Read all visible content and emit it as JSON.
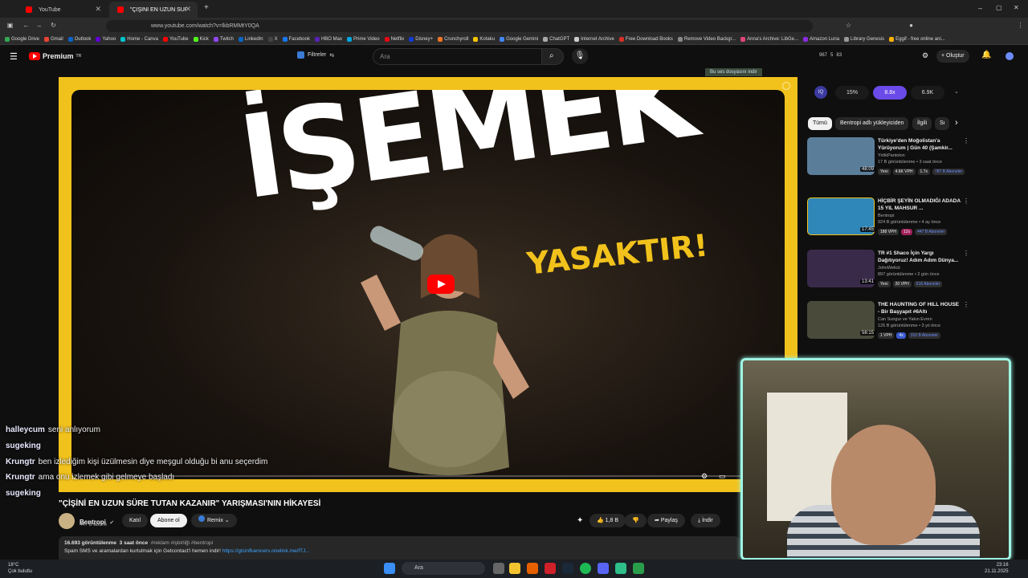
{
  "browser": {
    "tabs": [
      {
        "label": "YouTube"
      },
      {
        "label": "\"ÇİŞİNİ EN UZUN SÜRE TUTAN KAZANIR\" YARIŞ..."
      }
    ],
    "url": "www.youtube.com/watch?v=lkbRMMtY0QA",
    "bookmarks": [
      "Google Drive",
      "Gmail",
      "Outlook",
      "Yahoo",
      "Home - Canva",
      "YouTube",
      "Kick",
      "Twitch",
      "LinkedIn",
      "X",
      "Facebook",
      "HBO Max",
      "Prime Video",
      "Netflix",
      "Disney+",
      "Crunchyroll",
      "Kotaku",
      "Google Gemini",
      "ChatGPT",
      "Internet Archive",
      "Free Download Books",
      "Remove Video Backgr...",
      "Anna's Archive: LibGe...",
      "Amazon Luna",
      "Library Genesis",
      "Eggif - free online ani..."
    ]
  },
  "masthead": {
    "logo": "Premium",
    "logo_sup": "TR",
    "filter_label": "Filtreler",
    "search_placeholder": "Ara",
    "stats": [
      "967",
      "5",
      "83"
    ],
    "create_label": "Oluştur",
    "download_banner": "Bu ses dosyasını indir"
  },
  "video": {
    "thumb_title": "İŞEMEK",
    "thumb_subtitle": "YASAKTIR!",
    "title": "\"ÇİŞİNİ EN UZUN SÜRE TUTAN KAZANIR\" YARIŞMASI'NIN HİKAYESİ",
    "channel": "Bentropi",
    "subs": "447 B abone",
    "join": "Katıl",
    "subscribe": "Abone ol",
    "remix": "Remix",
    "likes": "1,8 B",
    "share": "Paylaş",
    "download": "İndir",
    "views": "16.693 görüntülenme",
    "time": "3 saat önce",
    "tags": "#reklam #işbirliği #bentropi",
    "desc_line": "Spam SMS ve aramalardan kurtulmak için Getcontact'i hemen indir!",
    "desc_link": "https://gtcinfluencers.onelink.me/fTJ..."
  },
  "chat": [
    {
      "user": "halleycum",
      "msg": "seni anlıyorum"
    },
    {
      "user": "sugeking",
      "msg": ""
    },
    {
      "user": "Krungtr",
      "msg": "ben izlediğim kişi üzülmesin diye meşgul olduğu bi anu seçerdim"
    },
    {
      "user": "Krungtr",
      "msg": "ama onu izlemek gibi gelmeye başladı"
    },
    {
      "user": "sugeking",
      "msg": ""
    }
  ],
  "sidebar": {
    "iq": [
      "15%",
      "8.8x",
      "6.9K"
    ],
    "chips": [
      "Tümü",
      "Bentropi adlı yükleyiciden",
      "İlgili",
      "Sı"
    ],
    "recs": [
      {
        "title": "Türkiye'den Moğolistan'a Yürüyorum | Gün 40 (Şamkir...",
        "channel": "YirtikPantolon",
        "meta": "17 B görüntülenme • 3 saat önce",
        "new": "Yeni",
        "duration": "48:09",
        "badges": [
          "4.6K VPH",
          "1.7x",
          "787 B Aboneler"
        ],
        "color": "#5a7d9a"
      },
      {
        "title": "HİÇBİR ŞEYİN OLMADIĞI ADADA 15 YIL MAHSUR ...",
        "channel": "Bentropi",
        "meta": "924 B görüntülenme • 4 ay önce",
        "new": "",
        "duration": "17:45",
        "badges": [
          "188 VPH",
          "12x",
          "447 B Aboneler"
        ],
        "color": "#2f86b8"
      },
      {
        "title": "TR #1 Shaco İçin Yargı Dağıtıyoruz! Adım Adım Dünya...",
        "channel": "JohnWelick",
        "meta": "897 görüntülenme • 2 gün önce",
        "new": "Yeni",
        "duration": "13:41",
        "badges": [
          "20 VPH",
          "616 Aboneler"
        ],
        "color": "#3a2a4a"
      },
      {
        "title": "THE HAUNTING OF HILL HOUSE - Bir Başyapıt #6Altı",
        "channel": "Can Sungur ve Yakın Evren",
        "meta": "126 B görüntülenme • 3 yıl önce",
        "new": "",
        "duration": "58:15",
        "badges": [
          "1 VPH",
          "4x",
          "310 B Aboneler"
        ],
        "color": "#4a4a3a"
      }
    ]
  },
  "taskbar": {
    "weather_temp": "18°C",
    "weather_desc": "Çok bulutlu",
    "search": "Ara",
    "time": "23:16",
    "date": "21.11.2025"
  }
}
